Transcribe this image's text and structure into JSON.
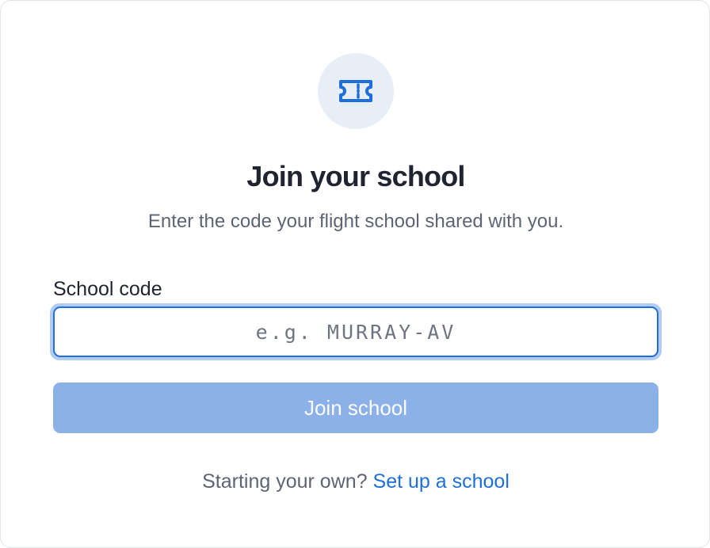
{
  "icon": "ticket-icon",
  "heading": {
    "title": "Join your school",
    "subtitle": "Enter the code your flight school shared with you."
  },
  "form": {
    "code_label": "School code",
    "code_value": "",
    "code_placeholder": "e.g. MURRAY-AV",
    "submit_label": "Join school"
  },
  "footer": {
    "prompt": "Starting your own?",
    "link_label": "Set up a school"
  },
  "colors": {
    "accent": "#1e6fd9",
    "button_disabled": "#8bb1e8",
    "icon_background": "#e8eef8",
    "heading_text": "#1f2430",
    "muted_text": "#5d6574"
  }
}
